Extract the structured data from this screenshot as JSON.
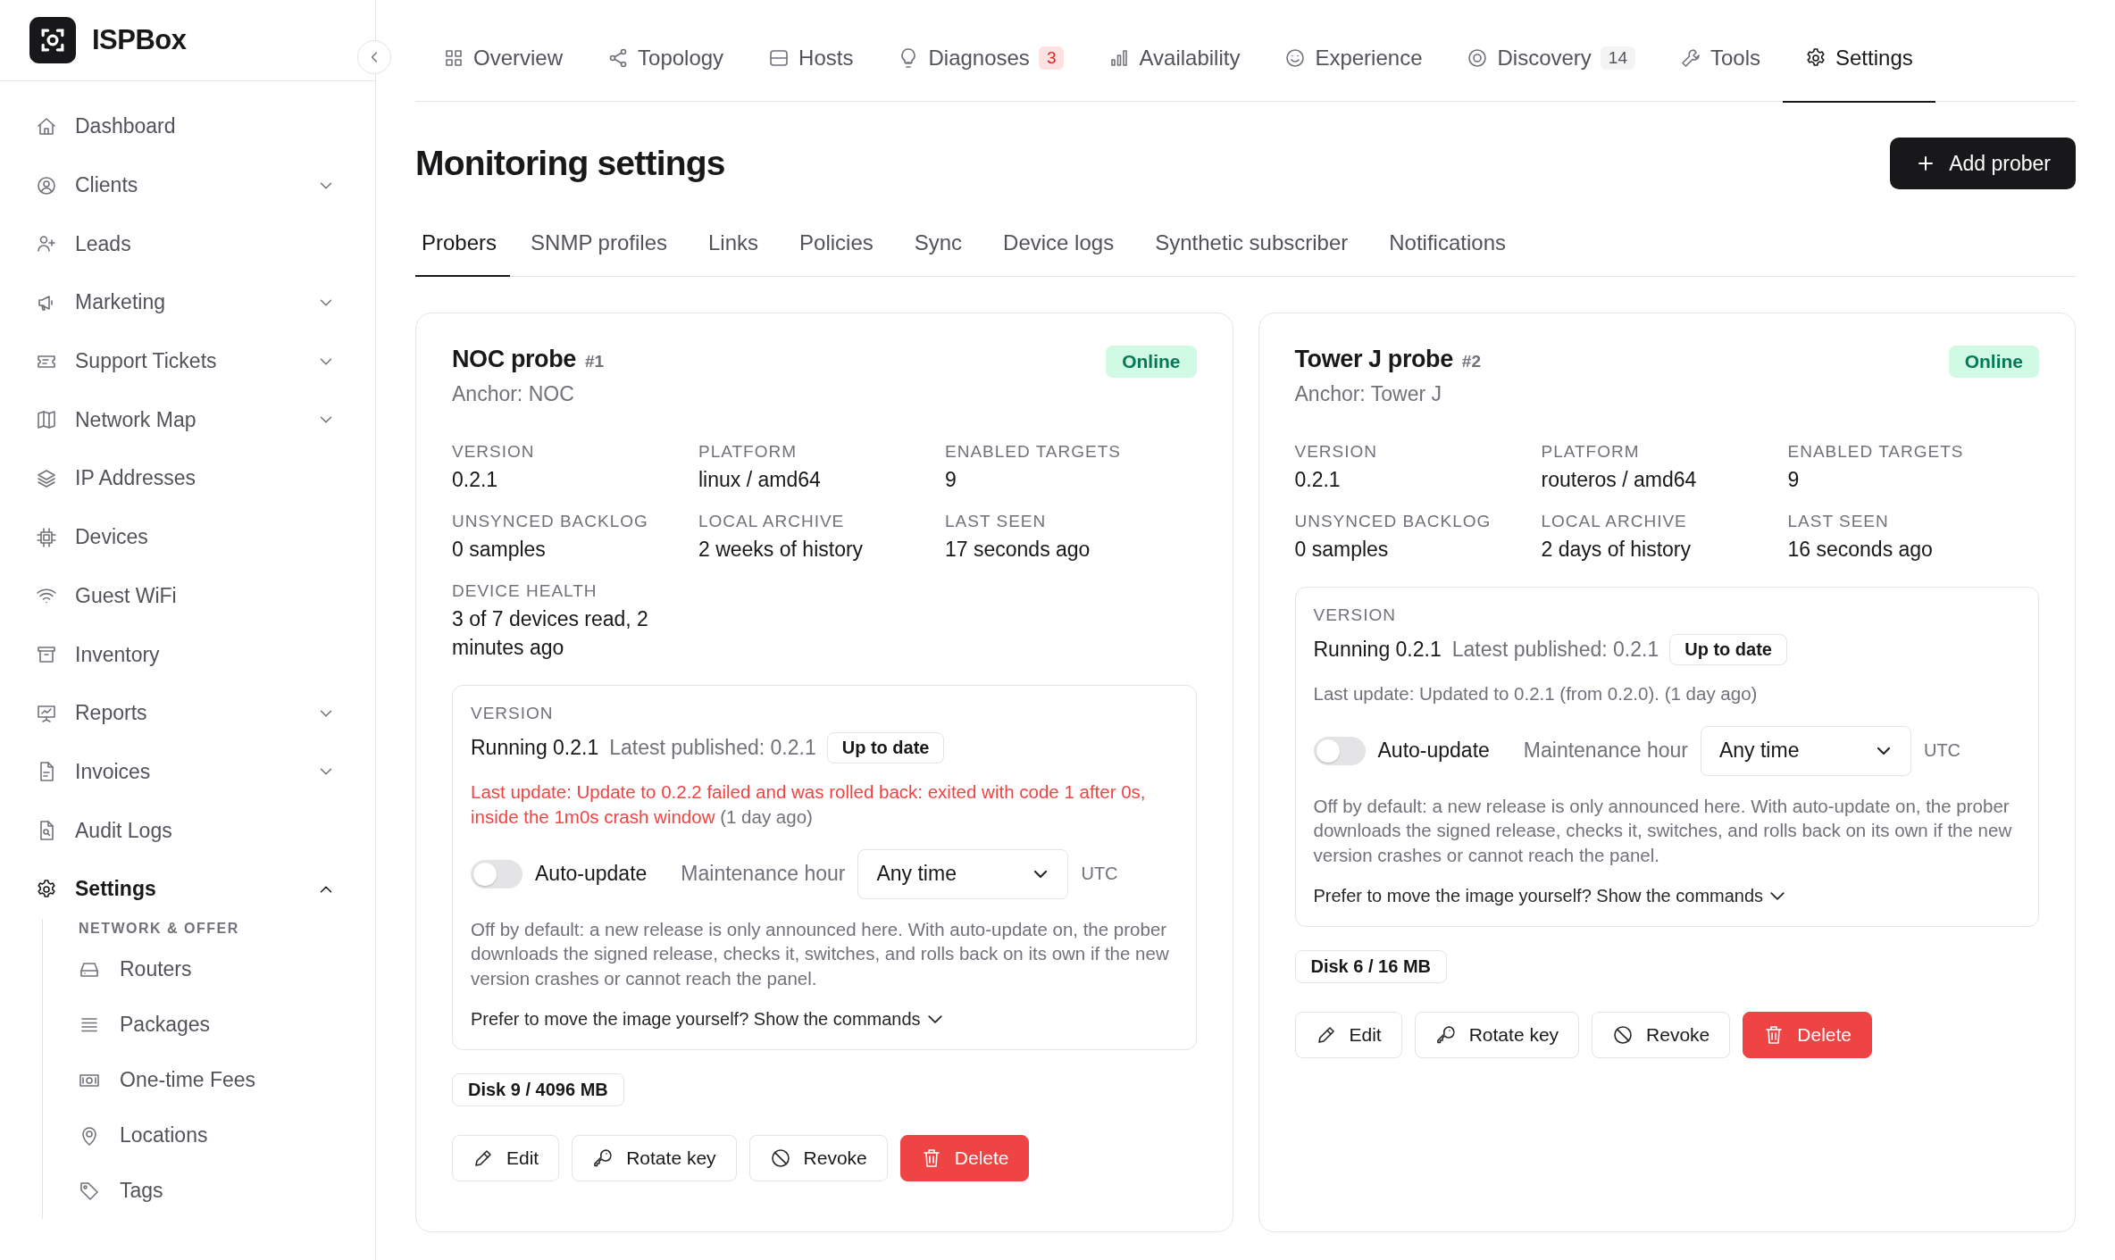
{
  "brand": {
    "name": "ISPBox"
  },
  "sidebar": {
    "items": [
      {
        "label": "Dashboard",
        "selected": false
      },
      {
        "label": "Clients",
        "selected": false,
        "expanded": false
      },
      {
        "label": "Leads",
        "selected": false
      },
      {
        "label": "Marketing",
        "selected": false,
        "expanded": false
      },
      {
        "label": "Support Tickets",
        "selected": false,
        "expanded": false
      },
      {
        "label": "Network Map",
        "selected": false,
        "expanded": false
      },
      {
        "label": "IP Addresses",
        "selected": false
      },
      {
        "label": "Devices",
        "selected": false
      },
      {
        "label": "Guest WiFi",
        "selected": false
      },
      {
        "label": "Inventory",
        "selected": false
      },
      {
        "label": "Reports",
        "selected": false,
        "expanded": false
      },
      {
        "label": "Invoices",
        "selected": false,
        "expanded": false
      },
      {
        "label": "Audit Logs",
        "selected": false
      },
      {
        "label": "Settings",
        "selected": true,
        "expanded": true
      }
    ],
    "section": "NETWORK & OFFER",
    "sub_items": [
      {
        "label": "Routers",
        "selected": false
      },
      {
        "label": "Packages",
        "selected": false
      },
      {
        "label": "One-time Fees",
        "selected": false
      },
      {
        "label": "Locations",
        "selected": false
      },
      {
        "label": "Tags",
        "selected": false
      }
    ]
  },
  "top_tabs": [
    {
      "label": "Overview",
      "selected": false
    },
    {
      "label": "Topology",
      "selected": false
    },
    {
      "label": "Hosts",
      "selected": false
    },
    {
      "label": "Diagnoses",
      "selected": false,
      "count": "3",
      "alert": true
    },
    {
      "label": "Availability",
      "selected": false
    },
    {
      "label": "Experience",
      "selected": false
    },
    {
      "label": "Discovery",
      "selected": false,
      "count": "14",
      "alert": false
    },
    {
      "label": "Tools",
      "selected": false
    },
    {
      "label": "Settings",
      "selected": true
    }
  ],
  "page": {
    "title": "Monitoring settings",
    "action": "Add prober"
  },
  "sub_tabs": [
    {
      "label": "Probers",
      "selected": true
    },
    {
      "label": "SNMP profiles",
      "selected": false
    },
    {
      "label": "Links",
      "selected": false
    },
    {
      "label": "Policies",
      "selected": false
    },
    {
      "label": "Sync",
      "selected": false
    },
    {
      "label": "Device logs",
      "selected": false
    },
    {
      "label": "Synthetic subscriber",
      "selected": false
    },
    {
      "label": "Notifications",
      "selected": false
    }
  ],
  "probers": [
    {
      "name": "NOC probe",
      "number": "#1",
      "anchor": "Anchor: NOC",
      "status": "Online",
      "fields": [
        {
          "label": "VERSION",
          "value": "0.2.1"
        },
        {
          "label": "PLATFORM",
          "value": "linux / amd64"
        },
        {
          "label": "ENABLED TARGETS",
          "value": "9"
        },
        {
          "label": "UNSYNCED BACKLOG",
          "value": "0 samples"
        },
        {
          "label": "LOCAL ARCHIVE",
          "value": "2 weeks of history"
        },
        {
          "label": "LAST SEEN",
          "value": "17 seconds ago"
        },
        {
          "label": "DEVICE HEALTH",
          "value": "3 of 7 devices read, 2 minutes ago"
        }
      ],
      "update": {
        "label": "VERSION",
        "running": "Running 0.2.1",
        "latest": "Latest published: 0.2.1",
        "badge": "Up to date",
        "last_update": "Last update: Update to 0.2.2 failed and was rolled back: exited with code 1 after 0s, inside the 1m0s crash window",
        "age": "(1 day ago)",
        "failed": true,
        "auto_update_label": "Auto-update",
        "auto_update": false,
        "hour_label": "Maintenance hour",
        "hour": "Any time",
        "tz": "UTC",
        "help": "Off by default: a new release is only announced here. With auto-update on, the prober downloads the signed release, checks it, switches, and rolls back on its own if the new version crashes or cannot reach the panel.",
        "commands_link": "Prefer to move the image yourself? Show the commands"
      },
      "disk": "Disk 9 / 4096 MB",
      "actions": [
        "Edit",
        "Rotate key",
        "Revoke",
        "Delete"
      ]
    },
    {
      "name": "Tower J probe",
      "number": "#2",
      "anchor": "Anchor: Tower J",
      "status": "Online",
      "fields": [
        {
          "label": "VERSION",
          "value": "0.2.1"
        },
        {
          "label": "PLATFORM",
          "value": "routeros / amd64"
        },
        {
          "label": "ENABLED TARGETS",
          "value": "9"
        },
        {
          "label": "UNSYNCED BACKLOG",
          "value": "0 samples"
        },
        {
          "label": "LOCAL ARCHIVE",
          "value": "2 days of history"
        },
        {
          "label": "LAST SEEN",
          "value": "16 seconds ago"
        }
      ],
      "update": {
        "label": "VERSION",
        "running": "Running 0.2.1",
        "latest": "Latest published: 0.2.1",
        "badge": "Up to date",
        "last_update": "Last update: Updated to 0.2.1 (from 0.2.0).",
        "age": "(1 day ago)",
        "failed": false,
        "auto_update_label": "Auto-update",
        "auto_update": false,
        "hour_label": "Maintenance hour",
        "hour": "Any time",
        "tz": "UTC",
        "help": "Off by default: a new release is only announced here. With auto-update on, the prober downloads the signed release, checks it, switches, and rolls back on its own if the new version crashes or cannot reach the panel.",
        "commands_link": "Prefer to move the image yourself? Show the commands"
      },
      "disk": "Disk 6 / 16 MB",
      "actions": [
        "Edit",
        "Rotate key",
        "Revoke",
        "Delete"
      ]
    }
  ]
}
